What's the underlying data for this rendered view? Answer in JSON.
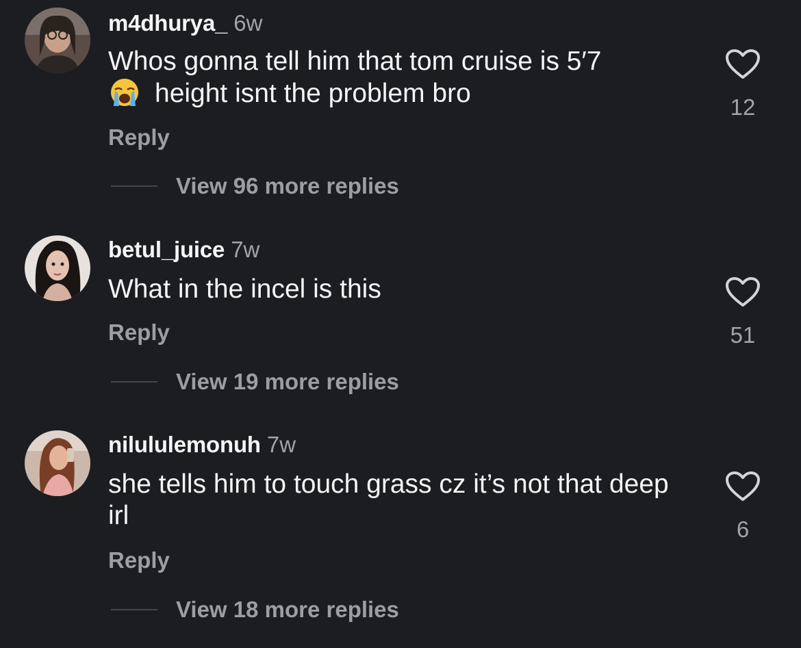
{
  "comments": [
    {
      "username": "m4dhurya_",
      "time": "6w",
      "text_line1": "Whos gonna tell him that tom cruise is 5′7",
      "text_line2": "height isnt the problem bro",
      "emoji": "loudly-crying-face",
      "reply_label": "Reply",
      "view_replies": "View 96 more replies",
      "likes": "12",
      "like_icon": "heart-outline-icon"
    },
    {
      "username": "betul_juice",
      "time": "7w",
      "text": "What in the incel is this",
      "reply_label": "Reply",
      "view_replies": "View 19 more replies",
      "likes": "51",
      "like_icon": "heart-outline-icon"
    },
    {
      "username": "nilululemonuh",
      "time": "7w",
      "text": "she tells him to touch grass cz it’s not that deep irl",
      "reply_label": "Reply",
      "view_replies": "View 18 more replies",
      "likes": "6",
      "like_icon": "heart-outline-icon"
    }
  ],
  "colors": {
    "background": "#1c1d21",
    "primary_text": "#f5f5f5",
    "secondary_text": "#9d9da3"
  }
}
